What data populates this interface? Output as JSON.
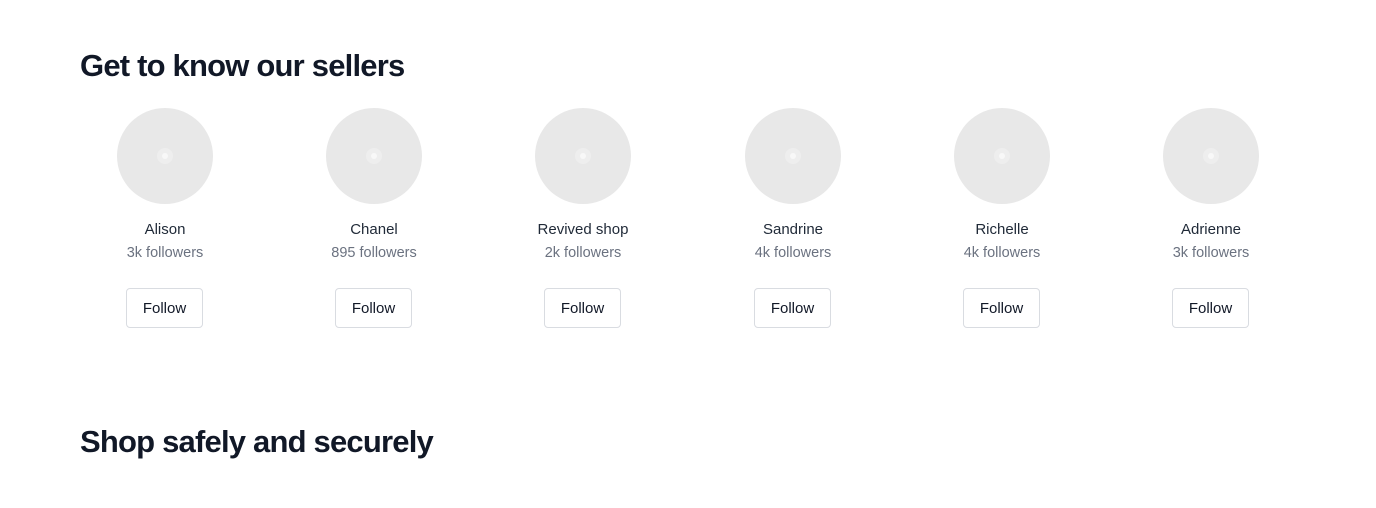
{
  "sections": {
    "sellers_title": "Get to know our sellers",
    "safety_title": "Shop safely and securely"
  },
  "sellers": [
    {
      "name": "Alison",
      "followers": "3k followers",
      "follow_label": "Follow"
    },
    {
      "name": "Chanel",
      "followers": "895 followers",
      "follow_label": "Follow"
    },
    {
      "name": "Revived shop",
      "followers": "2k followers",
      "follow_label": "Follow"
    },
    {
      "name": "Sandrine",
      "followers": "4k followers",
      "follow_label": "Follow"
    },
    {
      "name": "Richelle",
      "followers": "4k followers",
      "follow_label": "Follow"
    },
    {
      "name": "Adrienne",
      "followers": "3k followers",
      "follow_label": "Follow"
    }
  ],
  "colors": {
    "heading": "#111827",
    "secondary_text": "#6b7280",
    "avatar_placeholder": "#e8e8e8",
    "button_border": "#d9dce1"
  }
}
